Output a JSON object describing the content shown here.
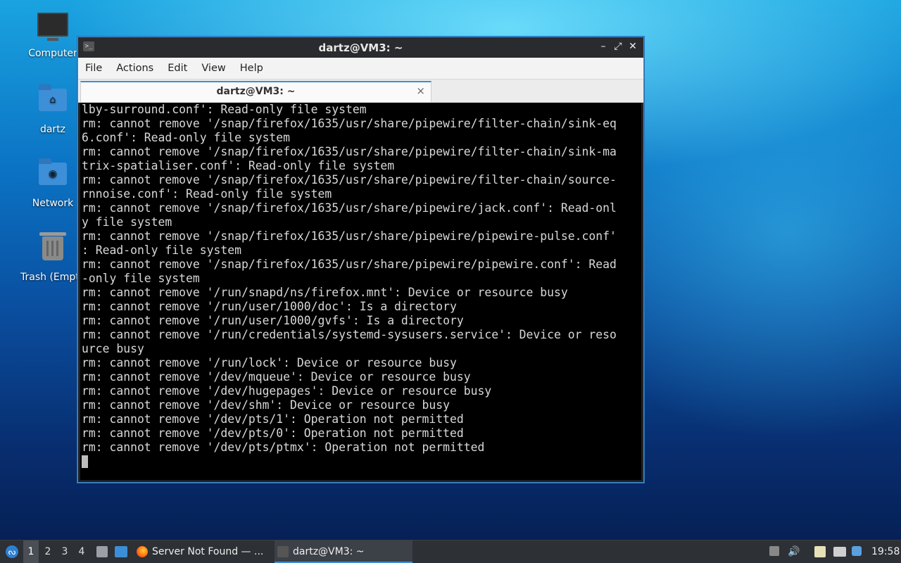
{
  "desktop": {
    "icons": [
      {
        "label": "Computer"
      },
      {
        "label": "dartz"
      },
      {
        "label": "Network"
      },
      {
        "label": "Trash (Empt"
      }
    ]
  },
  "window": {
    "title": "dartz@VM3: ~",
    "controls": {
      "minimize": "–",
      "maximize": "⤢",
      "close": "✕"
    },
    "menu": [
      "File",
      "Actions",
      "Edit",
      "View",
      "Help"
    ],
    "tab": {
      "label": "dartz@VM3: ~",
      "close": "×"
    },
    "terminal_lines": [
      "lby-surround.conf': Read-only file system",
      "rm: cannot remove '/snap/firefox/1635/usr/share/pipewire/filter-chain/sink-eq",
      "6.conf': Read-only file system",
      "rm: cannot remove '/snap/firefox/1635/usr/share/pipewire/filter-chain/sink-ma",
      "trix-spatialiser.conf': Read-only file system",
      "rm: cannot remove '/snap/firefox/1635/usr/share/pipewire/filter-chain/source-",
      "rnnoise.conf': Read-only file system",
      "rm: cannot remove '/snap/firefox/1635/usr/share/pipewire/jack.conf': Read-onl",
      "y file system",
      "rm: cannot remove '/snap/firefox/1635/usr/share/pipewire/pipewire-pulse.conf'",
      ": Read-only file system",
      "rm: cannot remove '/snap/firefox/1635/usr/share/pipewire/pipewire.conf': Read",
      "-only file system",
      "rm: cannot remove '/run/snapd/ns/firefox.mnt': Device or resource busy",
      "rm: cannot remove '/run/user/1000/doc': Is a directory",
      "rm: cannot remove '/run/user/1000/gvfs': Is a directory",
      "rm: cannot remove '/run/credentials/systemd-sysusers.service': Device or reso",
      "urce busy",
      "rm: cannot remove '/run/lock': Device or resource busy",
      "rm: cannot remove '/dev/mqueue': Device or resource busy",
      "rm: cannot remove '/dev/hugepages': Device or resource busy",
      "rm: cannot remove '/dev/shm': Device or resource busy",
      "rm: cannot remove '/dev/pts/1': Operation not permitted",
      "rm: cannot remove '/dev/pts/0': Operation not permitted",
      "rm: cannot remove '/dev/pts/ptmx': Operation not permitted"
    ]
  },
  "taskbar": {
    "workspaces": [
      "1",
      "2",
      "3",
      "4"
    ],
    "tasks": [
      {
        "label": "Server Not Found — ..."
      },
      {
        "label": "dartz@VM3: ~"
      }
    ],
    "clock": "19:58"
  },
  "colors": {
    "accent": "#3b8fd6",
    "terminal_bg": "#000000",
    "terminal_fg": "#d8d8d8"
  }
}
